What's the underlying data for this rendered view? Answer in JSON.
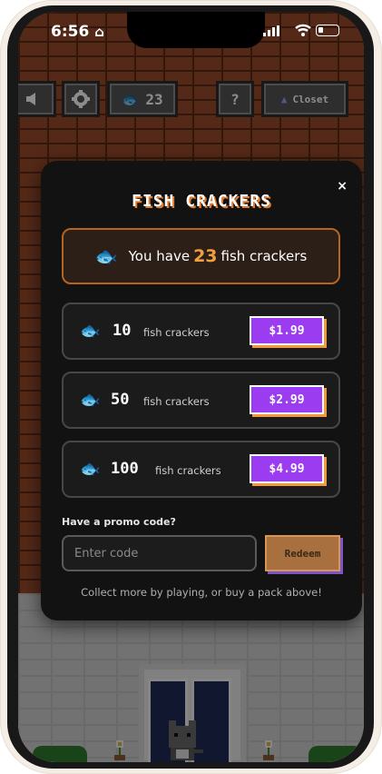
{
  "status": {
    "time": "6:56"
  },
  "game_header": {
    "coins": "23",
    "closet_label": "Closet",
    "help_label": "?"
  },
  "modal": {
    "title": "FISH CRACKERS",
    "close_label": "×",
    "balance": {
      "prefix": "You have",
      "amount": "23",
      "suffix": "fish crackers"
    },
    "packs": [
      {
        "qty": "10",
        "unit": "fish crackers",
        "price": "$1.99"
      },
      {
        "qty": "50",
        "unit": "fish crackers",
        "price": "$2.99"
      },
      {
        "qty": "100",
        "unit": "fish crackers",
        "price": "$4.99"
      }
    ],
    "promo": {
      "label": "Have a promo code?",
      "placeholder": "Enter code",
      "button": "Redeem"
    },
    "footer": "Collect more by playing, or buy a pack above!"
  },
  "colors": {
    "accent_orange": "#f29f3f",
    "price_purple": "#9b3cf0",
    "modal_bg": "#121212"
  }
}
